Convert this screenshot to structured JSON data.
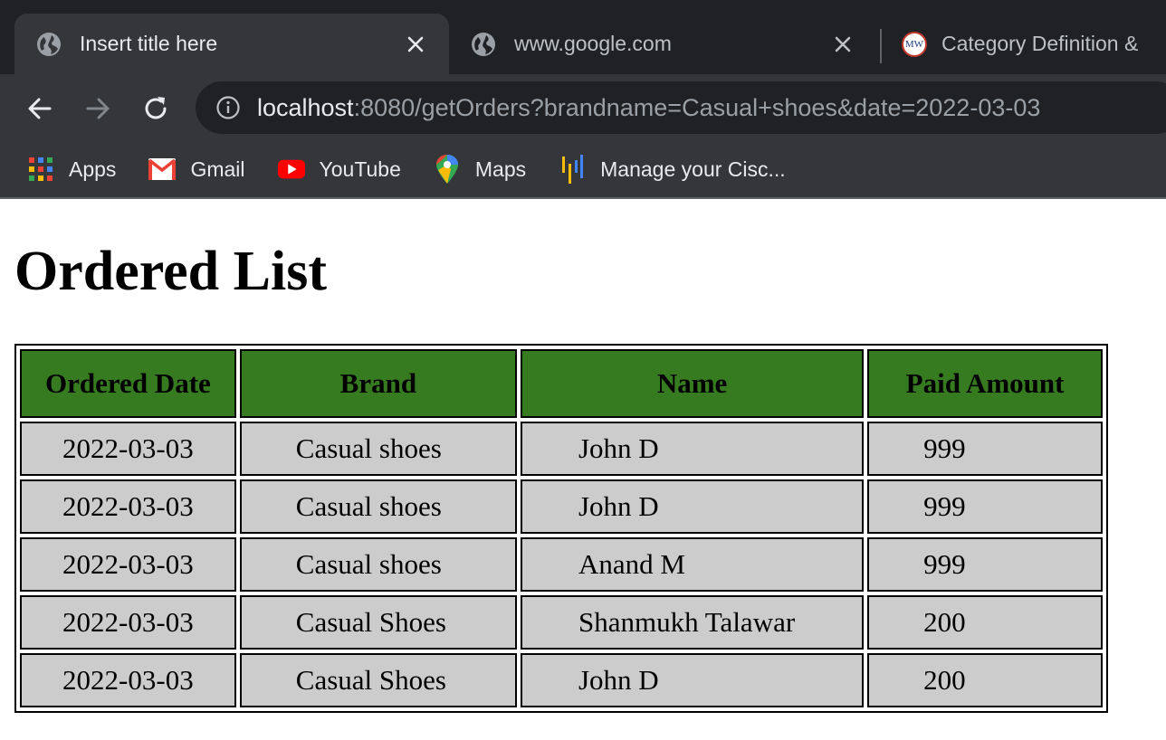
{
  "browser": {
    "tabs": [
      {
        "title": "Insert title here",
        "active": true,
        "favicon": "globe-icon"
      },
      {
        "title": "www.google.com",
        "active": false,
        "favicon": "globe-icon"
      },
      {
        "title": "Category Definition &",
        "active": false,
        "favicon": "mw-logo",
        "favicon_text": "MW"
      }
    ],
    "address_bar": {
      "host": "localhost",
      "rest": ":8080/getOrders?brandname=Casual+shoes&date=2022-03-03"
    },
    "bookmarks": [
      {
        "label": "Apps",
        "icon": "apps-grid-icon"
      },
      {
        "label": "Gmail",
        "icon": "gmail-icon"
      },
      {
        "label": "YouTube",
        "icon": "youtube-icon"
      },
      {
        "label": "Maps",
        "icon": "maps-pin-icon"
      },
      {
        "label": "Manage your Cisc...",
        "icon": "cisco-bars-icon"
      }
    ]
  },
  "page": {
    "heading": "Ordered List",
    "table": {
      "headers": [
        "Ordered Date",
        "Brand",
        "Name",
        "Paid Amount"
      ],
      "rows": [
        [
          "2022-03-03",
          "Casual shoes",
          "John D",
          "999"
        ],
        [
          "2022-03-03",
          "Casual shoes",
          "John D",
          "999"
        ],
        [
          "2022-03-03",
          "Casual shoes",
          "Anand M",
          "999"
        ],
        [
          "2022-03-03",
          "Casual Shoes",
          "Shanmukh Talawar",
          "200"
        ],
        [
          "2022-03-03",
          "Casual Shoes",
          "John D",
          "200"
        ]
      ]
    }
  },
  "colors": {
    "header_bg": "#367b20",
    "cell_bg": "#cccccc",
    "chrome_bg": "#35363a"
  }
}
